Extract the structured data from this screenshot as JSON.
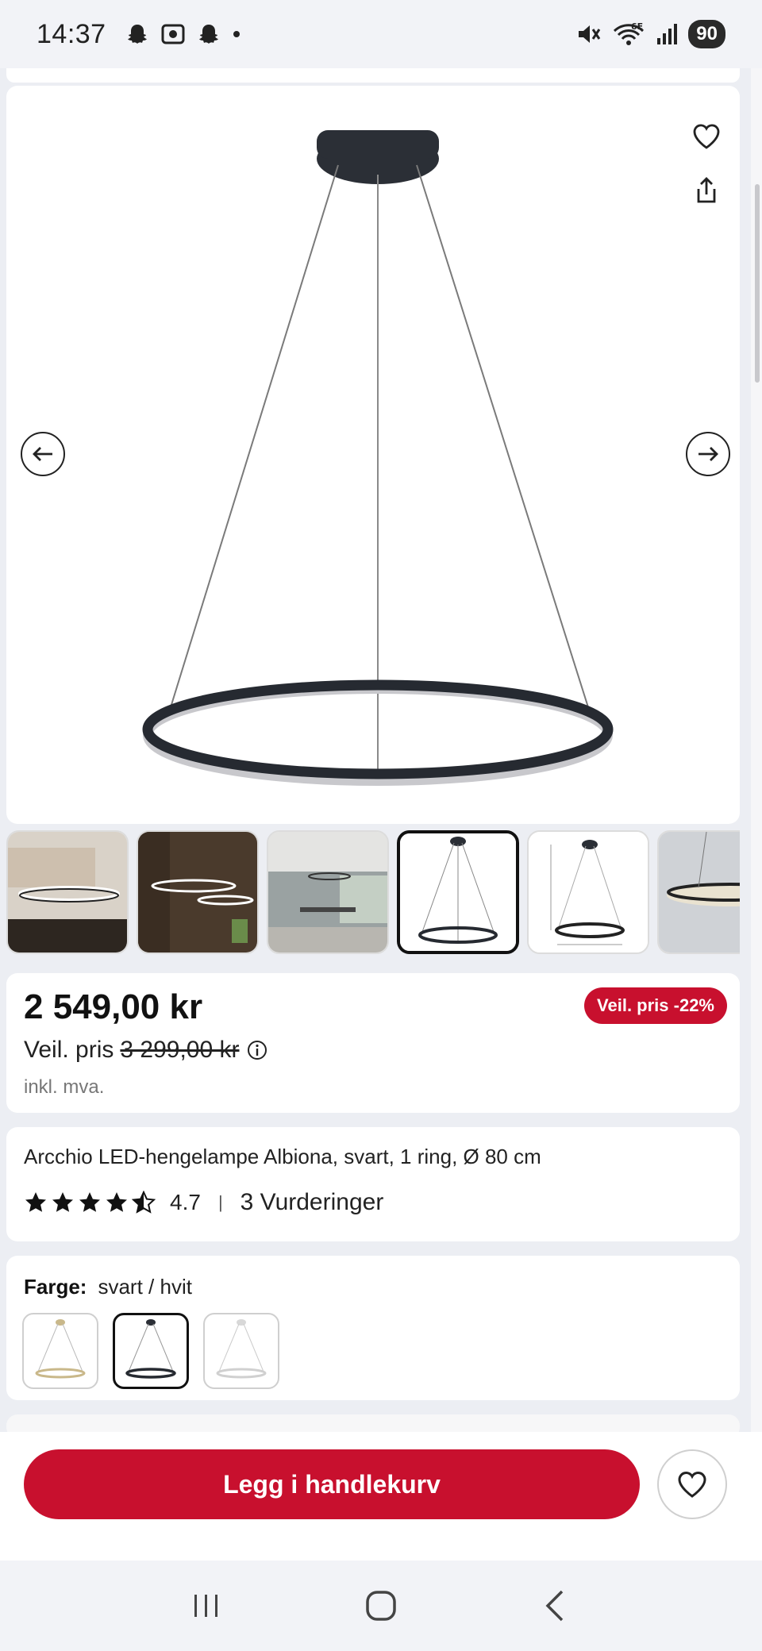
{
  "status_bar": {
    "time": "14:37",
    "battery": "90",
    "left_icons": [
      "snapchat-icon",
      "screenshot-icon",
      "snapchat-icon",
      "dot-icon"
    ],
    "right_icons": [
      "mute-icon",
      "wifi-6e-icon",
      "signal-icon"
    ]
  },
  "product": {
    "price": "2 549,00 kr",
    "rrp_label": "Veil. pris",
    "rrp_value": "3 299,00 kr",
    "vat_note": "inkl. mva.",
    "discount_badge": "Veil. pris -22%",
    "title": "Arcchio LED-hengelampe Albiona, svart, 1 ring, Ø 80 cm",
    "rating_value": "4.7",
    "rating_stars": 4.5,
    "rating_separator": "|",
    "rating_count": "3 Vurderinger"
  },
  "color_picker": {
    "label": "Farge:",
    "value": "svart / hvit"
  },
  "actions": {
    "add_to_cart": "Legg i handlekurv"
  },
  "colors": {
    "brand_red": "#c8102e",
    "text_dark": "#111111",
    "muted": "#777777"
  }
}
